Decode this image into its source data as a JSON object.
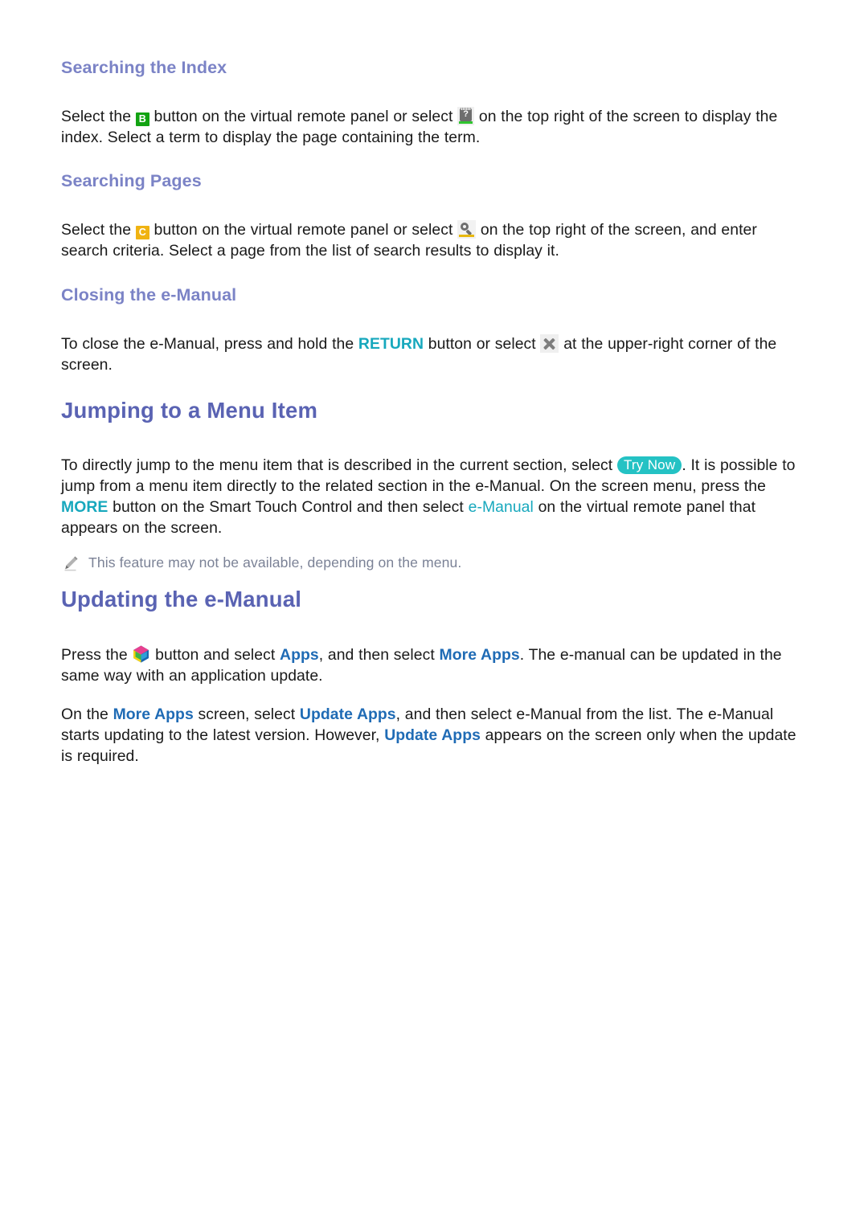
{
  "page": {
    "sections": [
      {
        "id": "searching-index",
        "heading": "Searching the Index",
        "heading_level": "sub",
        "paragraphs": [
          {
            "parts": [
              {
                "type": "text",
                "text": "Select the "
              },
              {
                "type": "keybtn",
                "text": "B",
                "color": "#12a312"
              },
              {
                "type": "text",
                "text": " button on the virtual remote panel or select "
              },
              {
                "type": "icon",
                "icon": "index-icon"
              },
              {
                "type": "text",
                "text": " on the top right of the screen to display the index. Select a term to display the page containing the term."
              }
            ]
          }
        ]
      },
      {
        "id": "searching-pages",
        "heading": "Searching Pages",
        "heading_level": "sub",
        "paragraphs": [
          {
            "parts": [
              {
                "type": "text",
                "text": "Select the "
              },
              {
                "type": "keybtn",
                "text": "C",
                "color": "#f0b312"
              },
              {
                "type": "text",
                "text": " button on the virtual remote panel or select "
              },
              {
                "type": "icon",
                "icon": "search-icon"
              },
              {
                "type": "text",
                "text": " on the top right of the screen, and enter search criteria. Select a page from the list of search results to display it."
              }
            ]
          }
        ]
      },
      {
        "id": "closing-emanual",
        "heading": "Closing the e-Manual",
        "heading_level": "sub",
        "paragraphs": [
          {
            "parts": [
              {
                "type": "text",
                "text": "To close the e-Manual, press and hold the "
              },
              {
                "type": "link-teal",
                "text": "RETURN"
              },
              {
                "type": "text",
                "text": " button or select "
              },
              {
                "type": "icon",
                "icon": "close-icon"
              },
              {
                "type": "text",
                "text": " at the upper-right corner of the screen."
              }
            ]
          }
        ]
      },
      {
        "id": "jumping-menu-item",
        "heading": "Jumping to a Menu Item",
        "heading_level": "main",
        "paragraphs": [
          {
            "parts": [
              {
                "type": "text",
                "text": "To directly jump to the menu item that is described in the current section, select "
              },
              {
                "type": "pill",
                "text": "Try Now"
              },
              {
                "type": "text",
                "text": ". It is possible to jump from a menu item directly to the related section in the e-Manual. On the screen menu, press the "
              },
              {
                "type": "link-teal",
                "text": "MORE"
              },
              {
                "type": "text",
                "text": " button on the Smart Touch Control and then select "
              },
              {
                "type": "link-teal-reg",
                "text": "e-Manual"
              },
              {
                "type": "text",
                "text": " on the virtual remote panel that appears on the screen."
              }
            ]
          }
        ],
        "note": {
          "icon": "pencil-icon",
          "text": "This feature may not be available, depending on the menu."
        }
      },
      {
        "id": "updating-emanual",
        "heading": "Updating the e-Manual",
        "heading_level": "main",
        "paragraphs": [
          {
            "parts": [
              {
                "type": "text",
                "text": "Press the "
              },
              {
                "type": "icon",
                "icon": "smart-hub-cube-icon"
              },
              {
                "type": "text",
                "text": " button and select "
              },
              {
                "type": "link-blue",
                "text": "Apps"
              },
              {
                "type": "text",
                "text": ", and then select "
              },
              {
                "type": "link-blue",
                "text": "More Apps"
              },
              {
                "type": "text",
                "text": ". The e-manual can be updated in the same way with an application update."
              }
            ]
          },
          {
            "parts": [
              {
                "type": "text",
                "text": "On the "
              },
              {
                "type": "link-blue",
                "text": "More Apps"
              },
              {
                "type": "text",
                "text": " screen, select "
              },
              {
                "type": "link-blue",
                "text": "Update Apps"
              },
              {
                "type": "text",
                "text": ", and then select e-Manual from the list. The e-Manual starts updating to the latest version. However, "
              },
              {
                "type": "link-blue",
                "text": "Update Apps"
              },
              {
                "type": "text",
                "text": " appears on the screen only when the update is required."
              }
            ]
          }
        ]
      }
    ]
  },
  "colors": {
    "sub_heading": "#7b83c6",
    "main_heading": "#5a63b3",
    "body_text": "#1a1a1a",
    "link_teal": "#17a8bd",
    "link_blue": "#1f6bb5",
    "pill_background": "#24c2c4",
    "pill_text": "#ffffff",
    "note_text": "#7b8296",
    "key_green": "#12a312",
    "key_yellow": "#f0b312"
  }
}
